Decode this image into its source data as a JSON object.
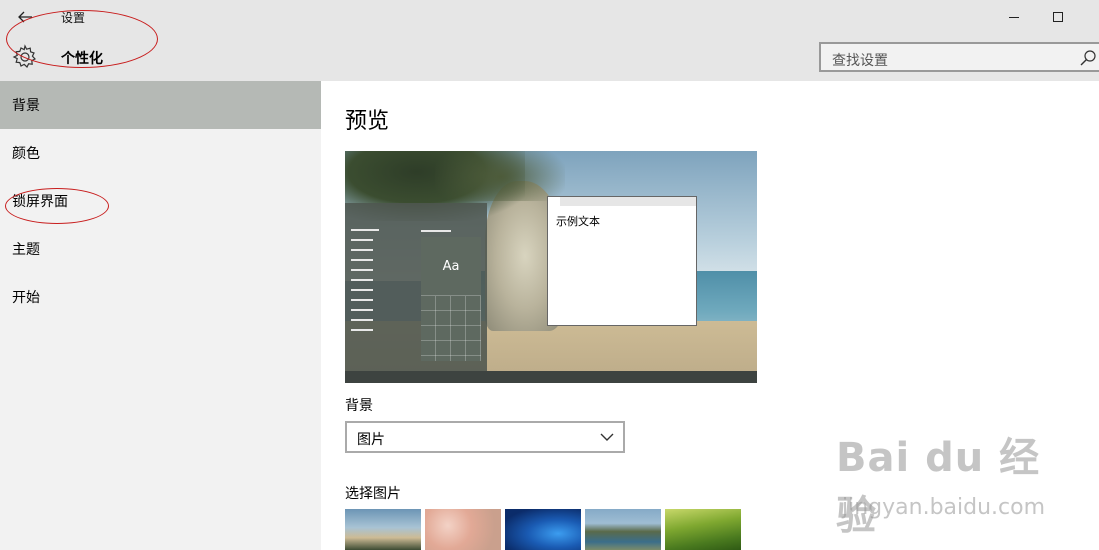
{
  "window": {
    "title": "设置",
    "back_icon": "back-arrow-icon",
    "minimize_icon": "minimize-icon",
    "maximize_icon": "maximize-icon"
  },
  "header": {
    "icon": "gear-icon",
    "title": "个性化",
    "search_placeholder": "查找设置",
    "search_icon": "search-icon"
  },
  "sidebar": {
    "items": [
      {
        "label": "背景",
        "active": true
      },
      {
        "label": "颜色",
        "active": false
      },
      {
        "label": "锁屏界面",
        "active": false
      },
      {
        "label": "主题",
        "active": false
      },
      {
        "label": "开始",
        "active": false
      }
    ]
  },
  "main": {
    "preview_title": "预览",
    "preview": {
      "tile_label": "Aa",
      "sample_text": "示例文本"
    },
    "background_label": "背景",
    "background_value": "图片",
    "choose_picture_label": "选择图片",
    "thumbnails": [
      "beach-rock",
      "pink-flowers",
      "windows-blue",
      "lake-rocks",
      "green-hills"
    ]
  },
  "watermark": {
    "logo": "Bai du 经验",
    "url": "jingyan.baidu.com"
  },
  "colors": {
    "titlebar_bg": "#e6e6e6",
    "sidebar_bg": "#f2f2f2",
    "active_item_bg": "#b5b9b5",
    "annotation_red": "#c81e1e"
  }
}
